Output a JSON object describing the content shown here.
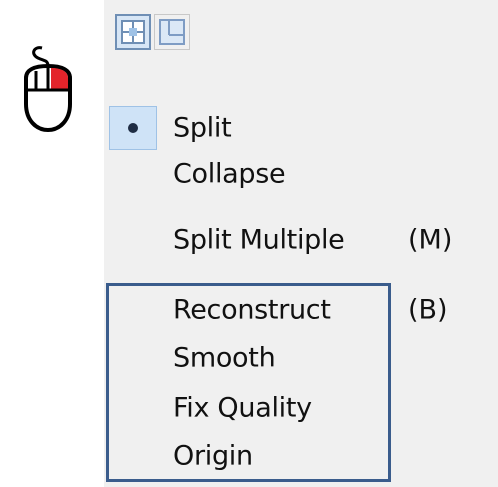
{
  "mouse": {
    "icon": "mouse-right-click-icon",
    "highlight_color": "#e3242b"
  },
  "toolbar": {
    "buttons": [
      {
        "icon": "split-view-icon"
      },
      {
        "icon": "layout-icon"
      }
    ]
  },
  "menu": {
    "items": [
      {
        "label": "Split",
        "shortcut": "",
        "selected": true
      },
      {
        "label": "Collapse",
        "shortcut": ""
      },
      {
        "label": "Split Multiple",
        "shortcut": "(M)"
      },
      {
        "label": "Reconstruct",
        "shortcut": "(B)"
      },
      {
        "label": "Smooth",
        "shortcut": ""
      },
      {
        "label": "Fix Quality",
        "shortcut": ""
      },
      {
        "label": "Origin",
        "shortcut": ""
      }
    ]
  },
  "colors": {
    "menu_background": "#f0f0f0",
    "selection_background": "#cfe3f7",
    "group_border": "#3a5c8c"
  }
}
